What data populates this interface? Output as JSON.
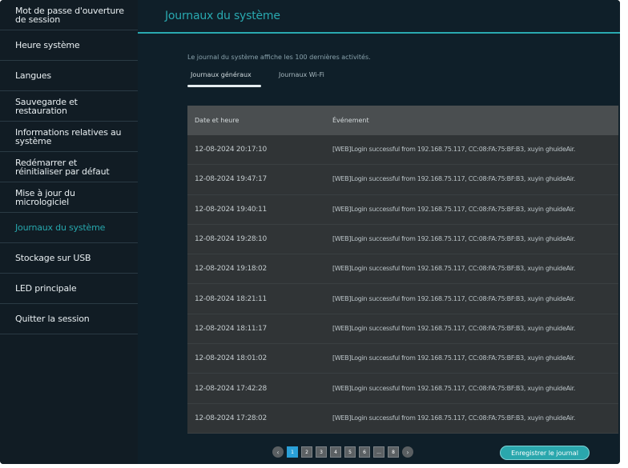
{
  "sidebar": {
    "items": [
      {
        "label": "Mot de passe d'ouverture\nde session",
        "active": false
      },
      {
        "label": "Heure système",
        "active": false
      },
      {
        "label": "Langues",
        "active": false
      },
      {
        "label": "Sauvegarde et\nrestauration",
        "active": false
      },
      {
        "label": "Informations relatives au\nsystème",
        "active": false
      },
      {
        "label": "Redémarrer et\nréinitialiser par défaut",
        "active": false
      },
      {
        "label": "Mise à jour du\nmicrologiciel",
        "active": false
      },
      {
        "label": "Journaux du système",
        "active": true
      },
      {
        "label": "Stockage sur USB",
        "active": false
      },
      {
        "label": "LED principale",
        "active": false
      },
      {
        "label": "Quitter la session",
        "active": false
      }
    ]
  },
  "main": {
    "title": "Journaux du système",
    "description": "Le journal du système affiche les 100 dernières activités.",
    "tabs": [
      {
        "label": "Journaux généraux",
        "selected": true
      },
      {
        "label": "Journaux Wi-Fi",
        "selected": false
      }
    ],
    "table": {
      "headers": {
        "date": "Date et heure",
        "event": "Événement"
      },
      "rows": [
        {
          "date": "12-08-2024 20:17:10",
          "event": "[WEB]Login successful from 192.168.75.117, CC:08:FA:75:BF:B3, xuyin ghuideAir."
        },
        {
          "date": "12-08-2024 19:47:17",
          "event": "[WEB]Login successful from 192.168.75.117, CC:08:FA:75:BF:B3, xuyin ghuideAir."
        },
        {
          "date": "12-08-2024 19:40:11",
          "event": "[WEB]Login successful from 192.168.75.117, CC:08:FA:75:BF:B3, xuyin ghuideAir."
        },
        {
          "date": "12-08-2024 19:28:10",
          "event": "[WEB]Login successful from 192.168.75.117, CC:08:FA:75:BF:B3, xuyin ghuideAir."
        },
        {
          "date": "12-08-2024 19:18:02",
          "event": "[WEB]Login successful from 192.168.75.117, CC:08:FA:75:BF:B3, xuyin ghuideAir."
        },
        {
          "date": "12-08-2024 18:21:11",
          "event": "[WEB]Login successful from 192.168.75.117, CC:08:FA:75:BF:B3, xuyin ghuideAir."
        },
        {
          "date": "12-08-2024 18:11:17",
          "event": "[WEB]Login successful from 192.168.75.117, CC:08:FA:75:BF:B3, xuyin ghuideAir."
        },
        {
          "date": "12-08-2024 18:01:02",
          "event": "[WEB]Login successful from 192.168.75.117, CC:08:FA:75:BF:B3, xuyin ghuideAir."
        },
        {
          "date": "12-08-2024 17:42:28",
          "event": "[WEB]Login successful from 192.168.75.117, CC:08:FA:75:BF:B3, xuyin ghuideAir."
        },
        {
          "date": "12-08-2024 17:28:02",
          "event": "[WEB]Login successful from 192.168.75.117, CC:08:FA:75:BF:B3, xuyin ghuideAir."
        }
      ]
    },
    "pagination": {
      "prev_icon": "chevron-left-icon",
      "next_icon": "chevron-right-icon",
      "pages": [
        "1",
        "2",
        "3",
        "4",
        "5",
        "6",
        "...",
        "8"
      ],
      "current": "1"
    },
    "save_button": "Enregistrer le journal"
  },
  "colors": {
    "accent": "#29a9b0",
    "background": "#0f1f29",
    "sidebar": "#111c24",
    "table": "#303436",
    "page_current": "#2aa0d8"
  }
}
